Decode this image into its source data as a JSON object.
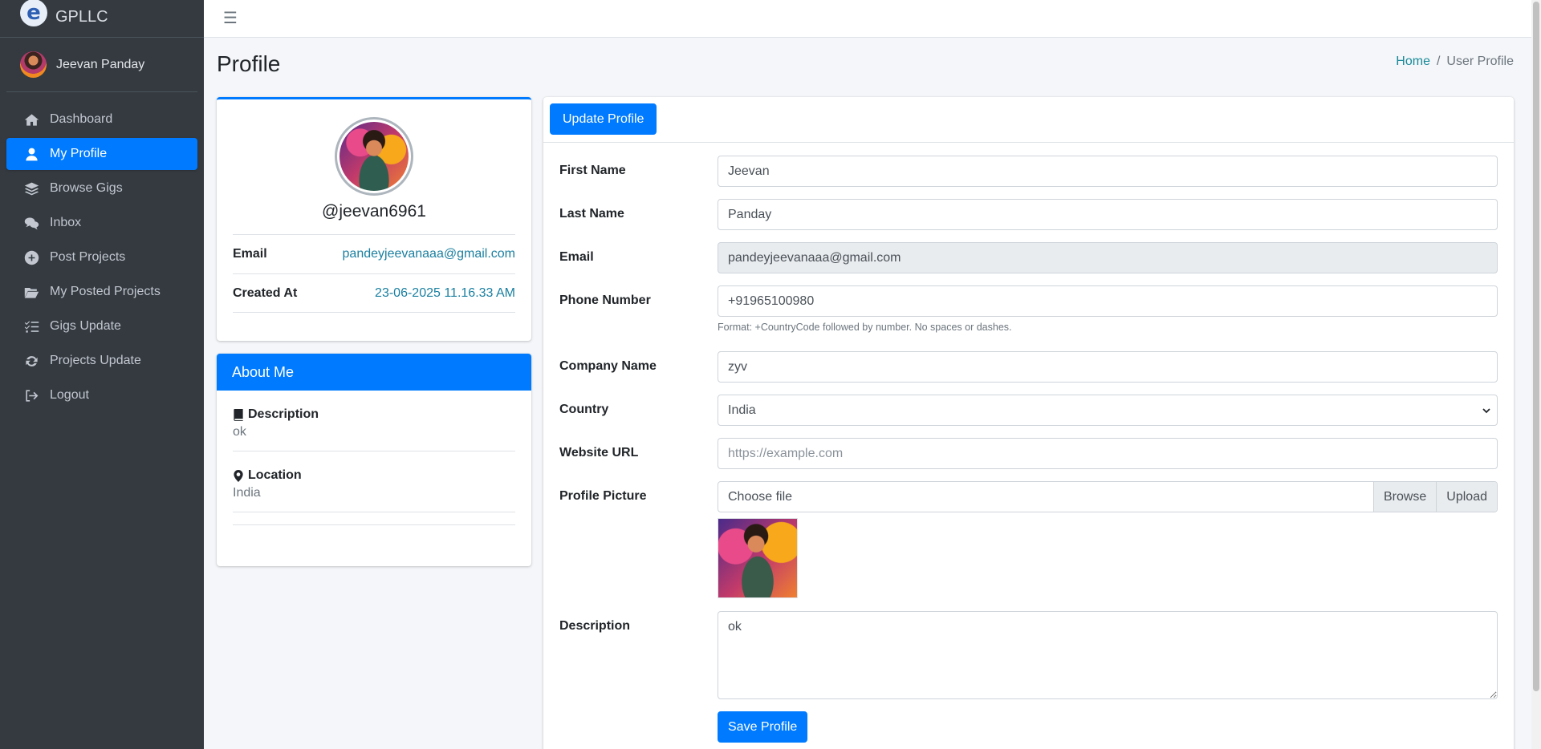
{
  "brand": {
    "name": "GPLLC",
    "logo_letter": "e"
  },
  "user": {
    "name": "Jeevan Panday"
  },
  "sidebar": {
    "items": [
      {
        "label": "Dashboard",
        "icon": "home-icon"
      },
      {
        "label": "My Profile",
        "icon": "user-icon",
        "active": true
      },
      {
        "label": "Browse Gigs",
        "icon": "layers-icon"
      },
      {
        "label": "Inbox",
        "icon": "comments-icon"
      },
      {
        "label": "Post Projects",
        "icon": "plus-circle-icon"
      },
      {
        "label": "My Posted Projects",
        "icon": "folder-open-icon"
      },
      {
        "label": "Gigs Update",
        "icon": "list-check-icon"
      },
      {
        "label": "Projects Update",
        "icon": "sync-icon"
      },
      {
        "label": "Logout",
        "icon": "sign-out-icon"
      }
    ]
  },
  "topbar": {
    "menu_icon": "☰"
  },
  "page": {
    "title": "Profile",
    "breadcrumb": {
      "home": "Home",
      "separator": "/",
      "current": "User Profile"
    }
  },
  "profile_card": {
    "username": "@jeevan6961",
    "email_label": "Email",
    "email_value": "pandeyjeevanaaa@gmail.com",
    "created_label": "Created At",
    "created_value": "23-06-2025 11.16.33 AM"
  },
  "about": {
    "title": "About Me",
    "description_label": "Description",
    "description_value": "ok",
    "location_label": "Location",
    "location_value": "India"
  },
  "form": {
    "tab_label": "Update Profile",
    "first_name": {
      "label": "First Name",
      "value": "Jeevan"
    },
    "last_name": {
      "label": "Last Name",
      "value": "Panday"
    },
    "email": {
      "label": "Email",
      "value": "pandeyjeevanaaa@gmail.com"
    },
    "phone": {
      "label": "Phone Number",
      "value": "+91965100980",
      "help": "Format: +CountryCode followed by number. No spaces or dashes."
    },
    "company": {
      "label": "Company Name",
      "value": "zyv"
    },
    "country": {
      "label": "Country",
      "value": "India"
    },
    "website": {
      "label": "Website URL",
      "placeholder": "https://example.com"
    },
    "picture": {
      "label": "Profile Picture",
      "file_text": "Choose file",
      "browse": "Browse",
      "upload": "Upload"
    },
    "description": {
      "label": "Description",
      "value": "ok"
    },
    "save_label": "Save Profile"
  }
}
